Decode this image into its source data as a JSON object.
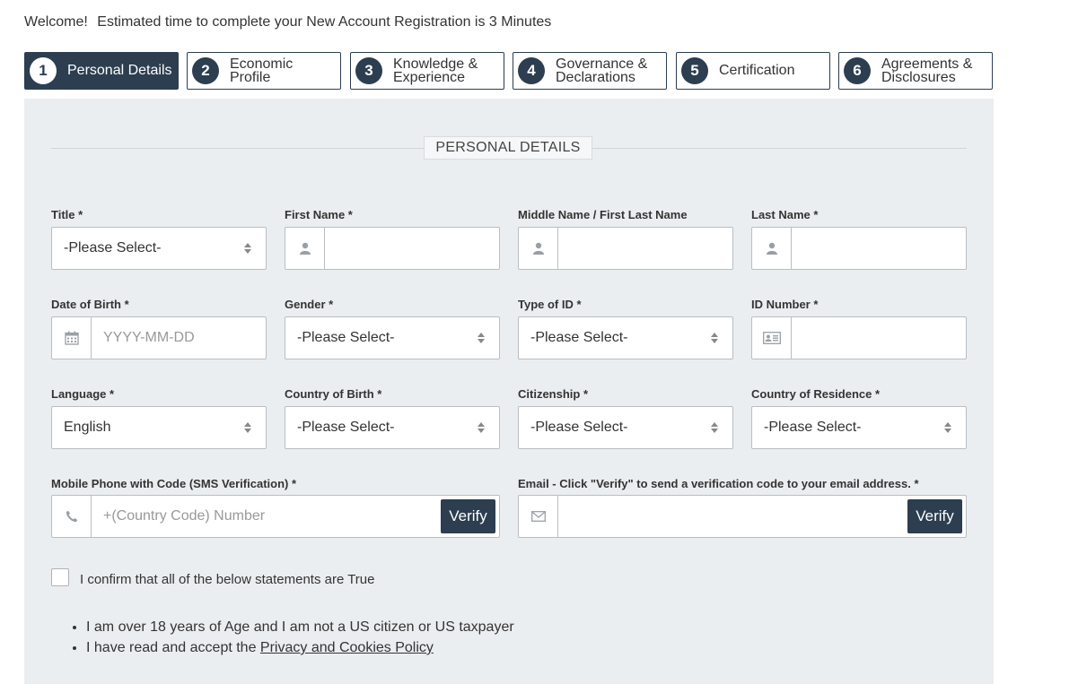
{
  "header": {
    "welcome_lead": "Welcome!",
    "welcome_text": "Estimated time to complete your New Account Registration is 3 Minutes"
  },
  "steps": [
    {
      "number": "1",
      "line1": "Personal Details",
      "line2": ""
    },
    {
      "number": "2",
      "line1": "Economic",
      "line2": "Profile"
    },
    {
      "number": "3",
      "line1": "Knowledge &",
      "line2": "Experience"
    },
    {
      "number": "4",
      "line1": "Governance &",
      "line2": "Declarations"
    },
    {
      "number": "5",
      "line1": "Certification",
      "line2": ""
    },
    {
      "number": "6",
      "line1": "Agreements &",
      "line2": "Disclosures"
    }
  ],
  "section": {
    "legend": "PERSONAL DETAILS"
  },
  "fields": {
    "title": {
      "label": "Title *",
      "value": "-Please Select-"
    },
    "first_name": {
      "label": "First Name *",
      "value": ""
    },
    "middle_name": {
      "label": "Middle Name / First Last Name",
      "value": ""
    },
    "last_name": {
      "label": "Last Name *",
      "value": ""
    },
    "dob": {
      "label": "Date of Birth *",
      "placeholder": "YYYY-MM-DD"
    },
    "gender": {
      "label": "Gender *",
      "value": "-Please Select-"
    },
    "id_type": {
      "label": "Type of ID *",
      "value": "-Please Select-"
    },
    "id_number": {
      "label": "ID Number *",
      "value": ""
    },
    "language": {
      "label": "Language *",
      "value": "English"
    },
    "country_birth": {
      "label": "Country of Birth *",
      "value": "-Please Select-"
    },
    "citizenship": {
      "label": "Citizenship *",
      "value": "-Please Select-"
    },
    "country_residence": {
      "label": "Country of Residence *",
      "value": "-Please Select-"
    },
    "mobile": {
      "label": "Mobile Phone with Code (SMS Verification) *",
      "placeholder": "+(Country Code) Number",
      "button": "Verify"
    },
    "email": {
      "label": "Email - Click \"Verify\" to send a verification code to your email address. *",
      "placeholder": "",
      "button": "Verify"
    }
  },
  "confirm": {
    "label": "I confirm that all of the below statements are True",
    "bullet1": "I am over 18 years of Age and I am not a US citizen or US taxpayer",
    "bullet2_prefix": "I have read and accept the",
    "bullet2_link": "Privacy and Cookies Policy"
  },
  "icons": [
    "user-icon",
    "calendar-icon",
    "id-card-icon",
    "phone-icon",
    "envelope-icon",
    "sort-arrows-icon"
  ],
  "colors": {
    "primary": "#2c3e50",
    "panel_bg": "#ebeef0"
  }
}
